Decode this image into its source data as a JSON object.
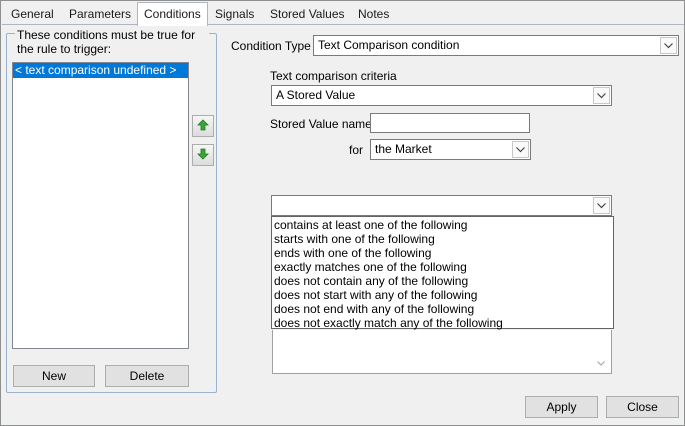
{
  "tabs": [
    {
      "label": "General"
    },
    {
      "label": "Parameters"
    },
    {
      "label": "Conditions"
    },
    {
      "label": "Signals"
    },
    {
      "label": "Stored Values"
    },
    {
      "label": "Notes"
    }
  ],
  "active_tab": "Conditions",
  "conditions_panel": {
    "caption": "These conditions must be true for the rule to trigger:",
    "items": [
      {
        "label": "< text comparison undefined >",
        "selected": true
      }
    ],
    "move_up_icon": "green-arrow-up-icon",
    "move_down_icon": "green-arrow-down-icon",
    "new_label": "New",
    "delete_label": "Delete"
  },
  "condition_type": {
    "label": "Condition Type",
    "value": "Text Comparison condition"
  },
  "criteria": {
    "label": "Text comparison criteria",
    "value": "A Stored Value"
  },
  "stored_value": {
    "label": "Stored Value name",
    "value": ""
  },
  "for_field": {
    "label": "for",
    "value": "the Market"
  },
  "comparison": {
    "value": "",
    "options": [
      "contains at least one of the following",
      "starts with one of the following",
      "ends with one of the following",
      "exactly matches one of the following",
      "does not contain any of the following",
      "does not start with any of the following",
      "does not end with any of the following",
      "does not exactly match any of the following"
    ]
  },
  "footer": {
    "apply_label": "Apply",
    "close_label": "Close"
  },
  "colors": {
    "selection": "#0078d7",
    "arrow_green": "#3aa63a",
    "tab_border": "#aeb6c3"
  }
}
